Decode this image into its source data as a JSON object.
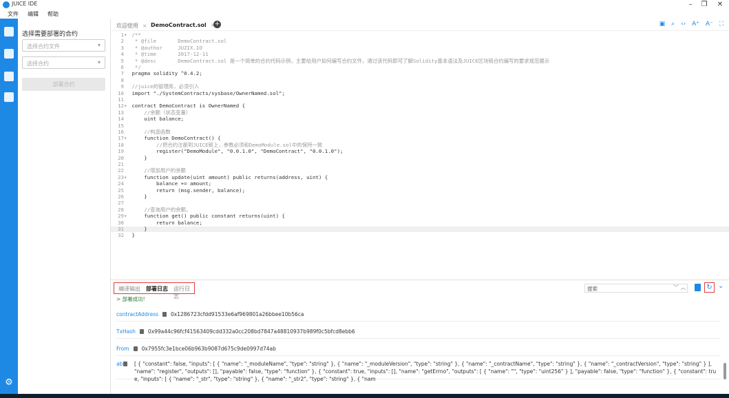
{
  "app": {
    "title": "JUICE IDE",
    "window_controls": {
      "minimize": "–",
      "maximize": "❐",
      "close": "✕"
    }
  },
  "menu": [
    "文件",
    "编辑",
    "帮助"
  ],
  "panel": {
    "title": "选择需要部署的合约",
    "file_select_placeholder": "选择合约文件",
    "contract_select_placeholder": "选择合约",
    "deploy_button": "部署合约"
  },
  "tabs": [
    {
      "label": "欢迎使用",
      "active": false
    },
    {
      "label": "DemoContract.sol",
      "active": true
    }
  ],
  "tab_close": "×",
  "code_lines": [
    "/**",
    " * @file       DemoContract.sol",
    " * @author     JUZIX.IO",
    " * @time       2017-12-11",
    " * @desc       DemoContract.sol 是一个简单的合约代码示例，主要给用户如何编写合约文件，通过该代码即可了解Solidity基本语法及JUICE区块链合约编写的要求规范展示",
    " */",
    "pragma solidity ^0.4.2;",
    "",
    "//juice的管理库，必须引入",
    "import \"./SystemContracts/sysbase/OwnerNamed.sol\";",
    "",
    "contract DemoContract is OwnerNamed {",
    "    //余额（状态变量）",
    "    uint balance;",
    "",
    "    //构造函数",
    "    function DemoContract() {",
    "        //把合约注册到JUICE链上，参数必须和DemoModule.sol中的保持一致",
    "        register(\"DemoModule\", \"0.0.1.0\", \"DemoContract\", \"0.0.1.0\");",
    "    }",
    "",
    "    //增加用户的余额",
    "    function update(uint amount) public returns(address, uint) {",
    "        balance += amount;",
    "        return (msg.sender, balance);",
    "    }",
    "",
    "    //查询用户的余额。",
    "    function get() public constant returns(uint) {",
    "        return balance;",
    "    }",
    "}"
  ],
  "bottom": {
    "tabs": [
      "编译输出",
      "部署日志",
      "运行日志"
    ],
    "active_tab": 1,
    "search_placeholder": "搜索",
    "success_msg": "> 部署成功!",
    "entries": [
      {
        "label": "contractAddress",
        "value": "0x1286723cfdd91533e6af969801a26bbee10b56ca"
      },
      {
        "label": "TxHash",
        "value": "0x99a44c96fcf41563409cdd332a0cc208bd7847a48810937b989f0c5bfcd8ebb6"
      },
      {
        "label": "From",
        "value": "0x7955fc3e1bce06b963b9087d675c9de0997d74ab"
      }
    ],
    "abi_label": "abi",
    "abi_value": "[ { \"constant\": false, \"inputs\": [ { \"name\": \"_moduleName\", \"type\": \"string\" }, { \"name\": \"_moduleVersion\", \"type\": \"string\" }, { \"name\": \"_contractName\", \"type\": \"string\" }, { \"name\": \"_contractVersion\", \"type\": \"string\" } ], \"name\": \"register\", \"outputs\": [], \"payable\": false, \"type\": \"function\" }, { \"constant\": true, \"inputs\": [], \"name\": \"getErrno\", \"outputs\": [ { \"name\": \"\", \"type\": \"uint256\" } ], \"payable\": false, \"type\": \"function\" }, { \"constant\": true, \"inputs\": [ { \"name\": \"_str\", \"type\": \"string\" }, { \"name\": \"_str2\", \"type\": \"string\" }, { \"nam"
  },
  "colors": {
    "accent": "#1e88e5",
    "highlight_border": "#e53935"
  }
}
